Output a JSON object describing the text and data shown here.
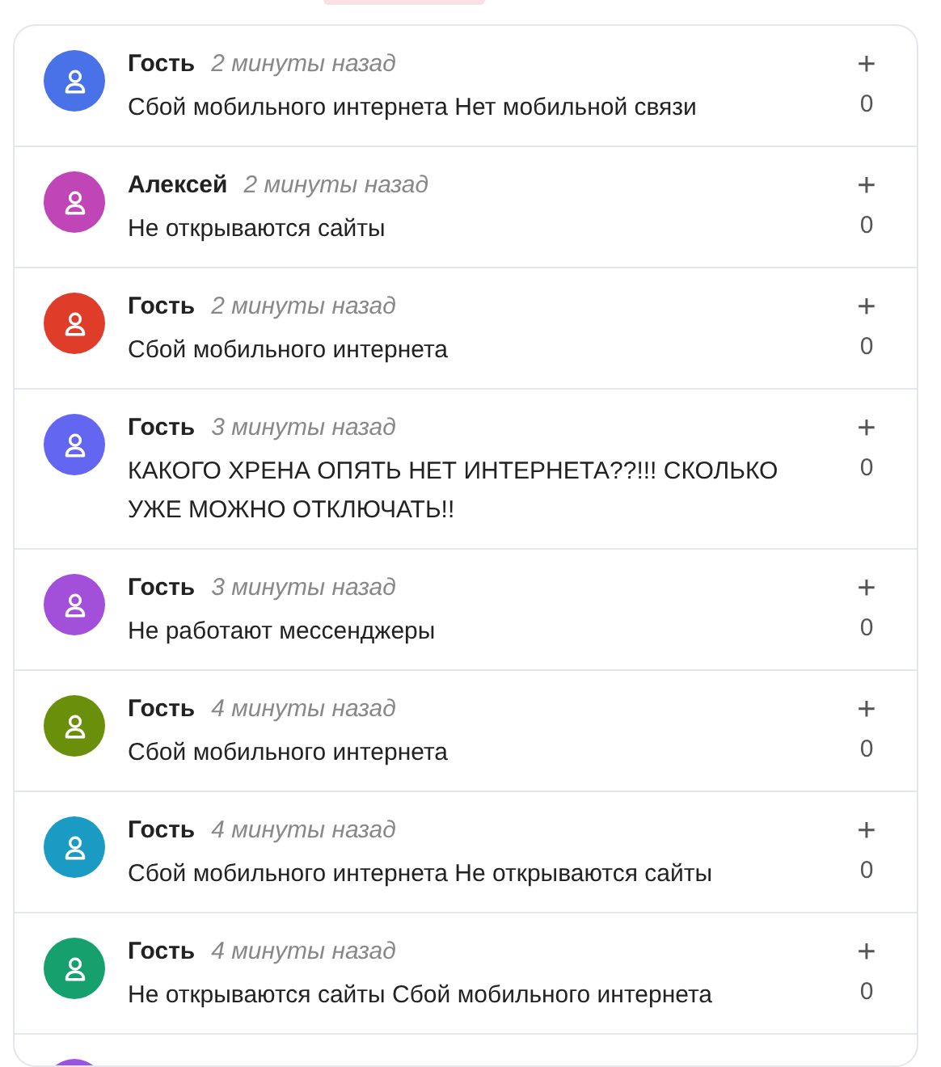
{
  "comments": [
    {
      "author": "Гость",
      "time": "2 минуты назад",
      "text": "Сбой мобильного интернета Нет мобильной связи",
      "vote_icon": "+",
      "votes": "0",
      "color": "#4a72e8"
    },
    {
      "author": "Алексей",
      "time": "2 минуты назад",
      "text": "Не открываются сайты",
      "vote_icon": "+",
      "votes": "0",
      "color": "#c046b8"
    },
    {
      "author": "Гость",
      "time": "2 минуты назад",
      "text": "Сбой мобильного интернета",
      "vote_icon": "+",
      "votes": "0",
      "color": "#e03c2a"
    },
    {
      "author": "Гость",
      "time": "3 минуты назад",
      "text": "КАКОГО ХРЕНА ОПЯТЬ НЕТ ИНТЕРНЕТА??!!! СКОЛЬКО УЖЕ МОЖНО ОТКЛЮЧАТЬ!!",
      "vote_icon": "+",
      "votes": "0",
      "color": "#6366f1"
    },
    {
      "author": "Гость",
      "time": "3 минуты назад",
      "text": "Не работают мессенджеры",
      "vote_icon": "+",
      "votes": "0",
      "color": "#a24fd9"
    },
    {
      "author": "Гость",
      "time": "4 минуты назад",
      "text": "Сбой мобильного интернета",
      "vote_icon": "+",
      "votes": "0",
      "color": "#6a8f0a"
    },
    {
      "author": "Гость",
      "time": "4 минуты назад",
      "text": "Сбой мобильного интернета Не открываются сайты",
      "vote_icon": "+",
      "votes": "0",
      "color": "#1a9bc4"
    },
    {
      "author": "Гость",
      "time": "4 минуты назад",
      "text": "Не открываются сайты Сбой мобильного интернета",
      "vote_icon": "+",
      "votes": "0",
      "color": "#16a06e"
    },
    {
      "color": "#9a55e0"
    }
  ]
}
